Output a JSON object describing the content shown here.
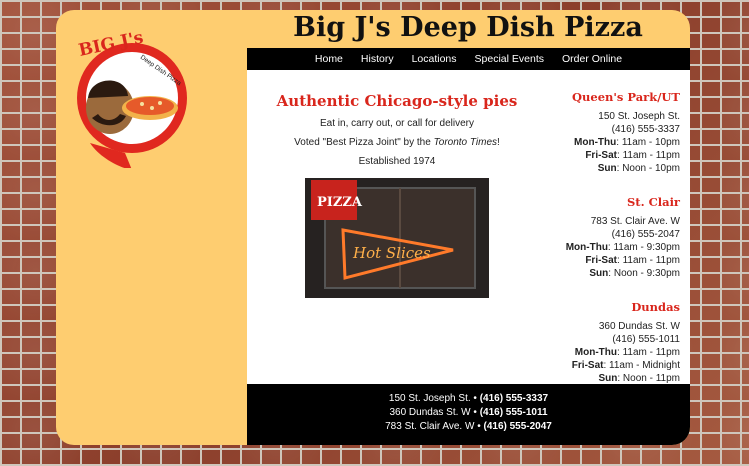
{
  "site": {
    "title": "Big J's Deep Dish Pizza",
    "logo_text_top": "BIG J's",
    "logo_text_side": "Deep Dish Pizza"
  },
  "nav": {
    "items": [
      "Home",
      "History",
      "Locations",
      "Special Events",
      "Order Online"
    ]
  },
  "main": {
    "tagline": "Authentic Chicago-style pies",
    "line1": "Eat in, carry out, or call for delivery",
    "line2_prefix": "Voted \"Best Pizza Joint\" by the ",
    "line2_source": "Toronto Times",
    "line2_suffix": "!",
    "line3": "Established 1974",
    "photo": {
      "sign_text": "PIZZA",
      "neon_text": "Hot Slices"
    }
  },
  "locations": [
    {
      "name": "Queen's Park/UT",
      "address": "150 St. Joseph St.",
      "phone": "(416) 555-3337",
      "hours": [
        {
          "days": "Mon-Thu",
          "time": "11am - 10pm"
        },
        {
          "days": "Fri-Sat",
          "time": "11am - 11pm"
        },
        {
          "days": "Sun",
          "time": "Noon - 10pm"
        }
      ]
    },
    {
      "name": "St. Clair",
      "address": "783 St. Clair Ave. W",
      "phone": "(416) 555-2047",
      "hours": [
        {
          "days": "Mon-Thu",
          "time": "11am - 9:30pm"
        },
        {
          "days": "Fri-Sat",
          "time": "11am - 11pm"
        },
        {
          "days": "Sun",
          "time": "Noon - 9:30pm"
        }
      ]
    },
    {
      "name": "Dundas",
      "address": "360 Dundas St. W",
      "phone": "(416) 555-1011",
      "hours": [
        {
          "days": "Mon-Thu",
          "time": "11am - 11pm"
        },
        {
          "days": "Fri-Sat",
          "time": "11am - Midnight"
        },
        {
          "days": "Sun",
          "time": "Noon - 11pm"
        }
      ]
    }
  ],
  "footer": {
    "lines": [
      {
        "address": "150 St. Joseph St.",
        "phone": "(416) 555-3337"
      },
      {
        "address": "360 Dundas St. W",
        "phone": "(416) 555-1011"
      },
      {
        "address": "783 St. Clair Ave. W",
        "phone": "(416) 555-2047"
      }
    ]
  },
  "colors": {
    "frame_bg": "#fecd70",
    "accent_red": "#d9261c",
    "nav_bg": "#000000"
  }
}
